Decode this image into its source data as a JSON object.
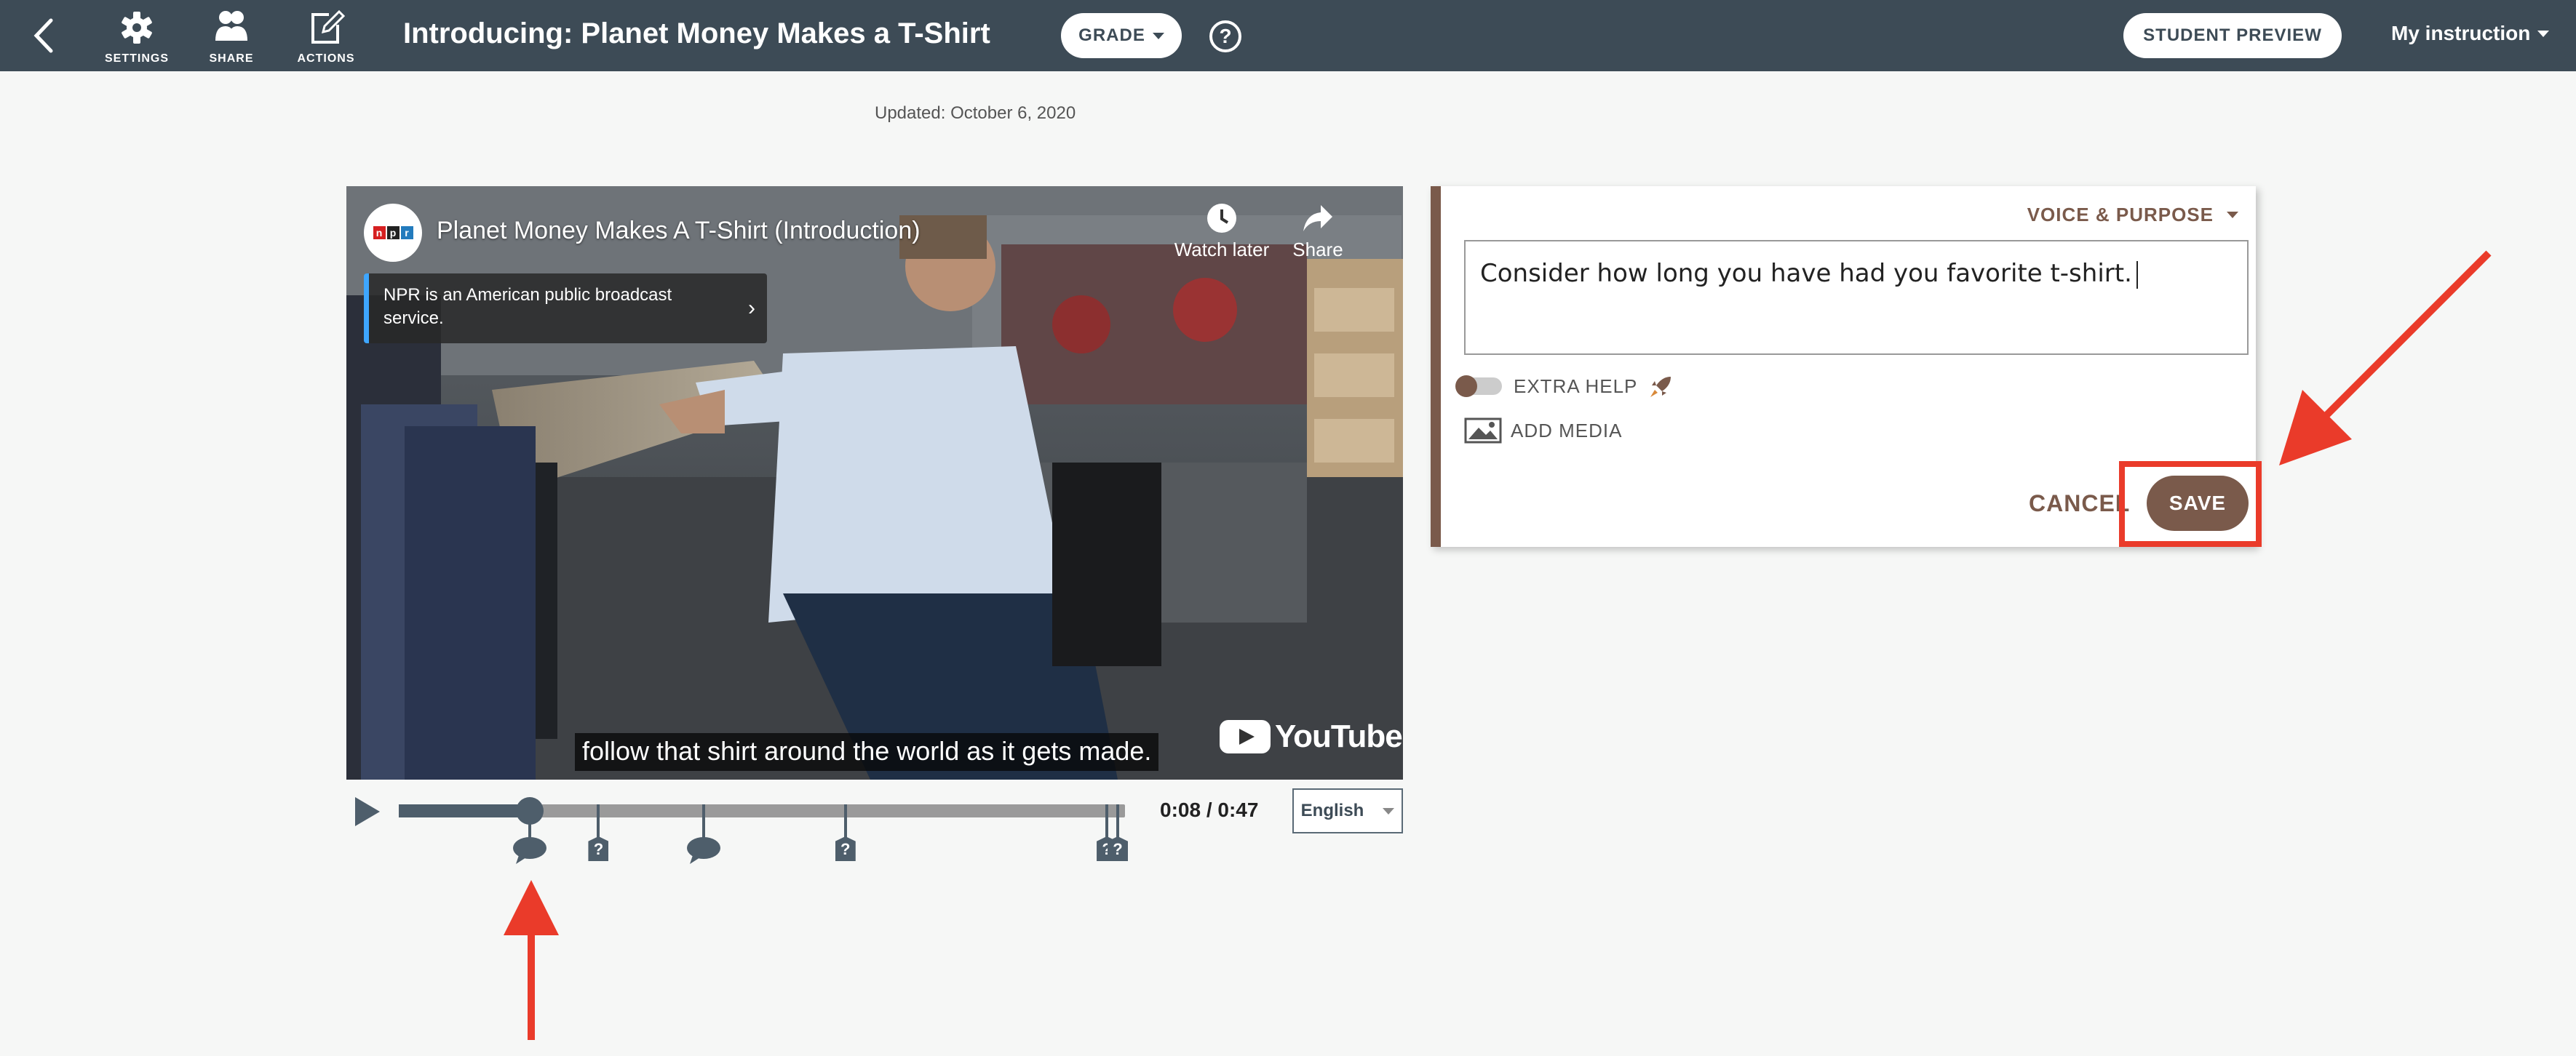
{
  "header": {
    "title": "Introducing: Planet Money Makes a T-Shirt",
    "tools": [
      {
        "label": "SETTINGS",
        "icon": "gear-icon"
      },
      {
        "label": "SHARE",
        "icon": "people-icon"
      },
      {
        "label": "ACTIONS",
        "icon": "edit-icon"
      }
    ],
    "grade_label": "GRADE",
    "help_label": "?",
    "student_preview_label": "STUDENT PREVIEW",
    "my_instruction_label": "My instruction"
  },
  "updated_text": "Updated: October 6, 2020",
  "video": {
    "title": "Planet Money Makes A T-Shirt (Introduction)",
    "npr_letters": [
      "n",
      "p",
      "r"
    ],
    "watch_later_label": "Watch later",
    "share_label": "Share",
    "info_card_text": "NPR is an American public broadcast service.",
    "caption": "follow that shirt around the world as it gets made.",
    "youtube_label": "YouTube"
  },
  "player": {
    "progress_fraction": 0.18,
    "timecode": "0:08 / 0:47",
    "language": "English",
    "markers": [
      {
        "type": "comment",
        "fraction": 0.18
      },
      {
        "type": "question",
        "fraction": 0.275,
        "label": "?"
      },
      {
        "type": "comment",
        "fraction": 0.42
      },
      {
        "type": "question",
        "fraction": 0.615,
        "label": "?"
      },
      {
        "type": "question",
        "fraction": 0.975,
        "label": "?"
      },
      {
        "type": "question",
        "fraction": 0.99,
        "label": "?"
      }
    ]
  },
  "editor": {
    "voice_purpose_label": "VOICE & PURPOSE",
    "text_value": "Consider how long you have had you favorite t-shirt.",
    "extra_help_label": "EXTRA HELP",
    "add_media_label": "ADD MEDIA",
    "cancel_label": "CANCEL",
    "save_label": "SAVE"
  },
  "colors": {
    "topbar": "#3d4b56",
    "accent_brown": "#7a5a4b",
    "annotation_red": "#ea3b2a",
    "info_card_border": "#3ea6ff"
  }
}
